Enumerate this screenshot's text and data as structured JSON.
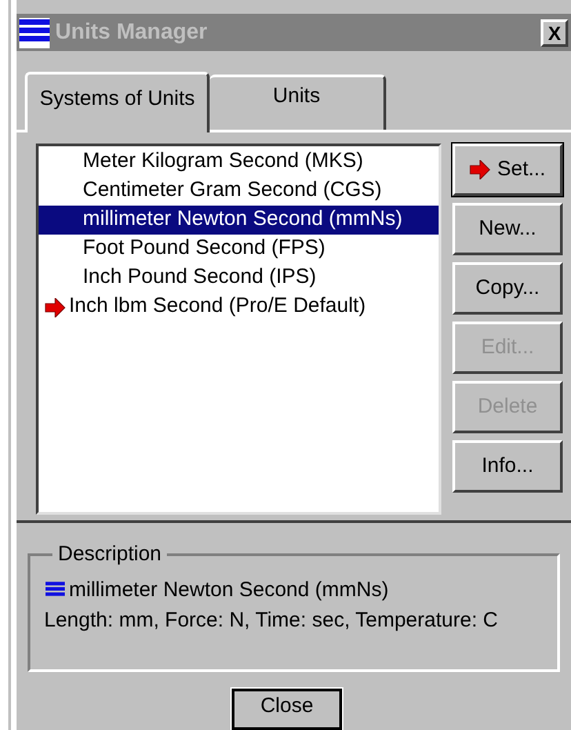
{
  "window": {
    "title": "Units Manager",
    "close": "X"
  },
  "tabs": [
    {
      "label": "Systems of Units",
      "selected": true
    },
    {
      "label": "Units",
      "selected": false
    }
  ],
  "systems": [
    {
      "label": "Meter Kilogram Second (MKS)",
      "selected": false,
      "current": false
    },
    {
      "label": "Centimeter Gram Second (CGS)",
      "selected": false,
      "current": false
    },
    {
      "label": "millimeter Newton Second (mmNs)",
      "selected": true,
      "current": false
    },
    {
      "label": "Foot Pound Second (FPS)",
      "selected": false,
      "current": false
    },
    {
      "label": "Inch Pound Second (IPS)",
      "selected": false,
      "current": false
    },
    {
      "label": "Inch lbm Second (Pro/E Default)",
      "selected": false,
      "current": true
    }
  ],
  "buttons": [
    {
      "label": "Set...",
      "disabled": false,
      "arrow": true
    },
    {
      "label": "New...",
      "disabled": false,
      "arrow": false
    },
    {
      "label": "Copy...",
      "disabled": false,
      "arrow": false
    },
    {
      "label": "Edit...",
      "disabled": true,
      "arrow": false
    },
    {
      "label": "Delete",
      "disabled": true,
      "arrow": false
    },
    {
      "label": "Info...",
      "disabled": false,
      "arrow": false
    }
  ],
  "description": {
    "legend": "Description",
    "name": "millimeter Newton Second (mmNs)",
    "details": "Length: mm, Force: N, Time: sec, Temperature: C"
  },
  "close_button": "Close"
}
